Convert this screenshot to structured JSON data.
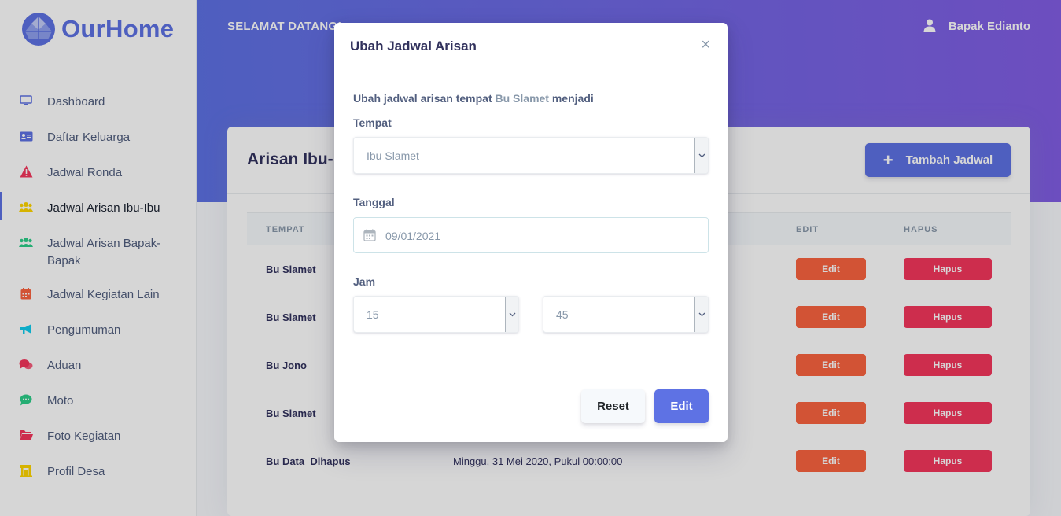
{
  "brand": {
    "name": "OurHome",
    "color": "#5e72e4"
  },
  "sidebar": {
    "items": [
      {
        "label": "Dashboard",
        "icon": "monitor-icon",
        "color": "#5e72e4"
      },
      {
        "label": "Daftar Keluarga",
        "icon": "id-card-icon",
        "color": "#5e72e4"
      },
      {
        "label": "Jadwal Ronda",
        "icon": "warning-icon",
        "color": "#f5365c"
      },
      {
        "label": "Jadwal Arisan Ibu-Ibu",
        "icon": "users-icon",
        "color": "#ffd600"
      },
      {
        "label": "Jadwal Arisan Bapak-Bapak",
        "icon": "users-icon",
        "color": "#2dce89"
      },
      {
        "label": "Jadwal Kegiatan Lain",
        "icon": "calendar-icon",
        "color": "#fb6340"
      },
      {
        "label": "Pengumuman",
        "icon": "megaphone-icon",
        "color": "#11cdef"
      },
      {
        "label": "Aduan",
        "icon": "comments-icon",
        "color": "#f5365c"
      },
      {
        "label": "Moto",
        "icon": "chat-bubble-icon",
        "color": "#2dce89"
      },
      {
        "label": "Foto Kegiatan",
        "icon": "folder-icon",
        "color": "#f5365c"
      },
      {
        "label": "Profil Desa",
        "icon": "building-icon",
        "color": "#ffd600"
      }
    ],
    "active_index": 3
  },
  "header": {
    "welcome": "SELAMAT DATANG!",
    "user_name": "Bapak Edianto"
  },
  "card": {
    "title": "Arisan Ibu-I",
    "add_button": "Tambah Jadwal",
    "columns": {
      "tempat": "TEMPAT",
      "edit": "EDIT",
      "hapus": "HAPUS"
    },
    "rows": [
      {
        "tempat": "Bu Slamet",
        "jadwal": ""
      },
      {
        "tempat": "Bu Slamet",
        "jadwal": ""
      },
      {
        "tempat": "Bu Jono",
        "jadwal": ""
      },
      {
        "tempat": "Bu Slamet",
        "jadwal": ""
      },
      {
        "tempat": "Bu Data_Dihapus",
        "jadwal": "Minggu, 31 Mei 2020, Pukul 00:00:00"
      }
    ],
    "edit_label": "Edit",
    "delete_label": "Hapus"
  },
  "modal": {
    "title": "Ubah Jadwal Arisan",
    "close": "×",
    "intro_prefix": "Ubah jadwal arisan tempat",
    "intro_name": "Bu Slamet",
    "intro_suffix": "menjadi",
    "tempat_label": "Tempat",
    "tempat_value": "Ibu Slamet",
    "tanggal_label": "Tanggal",
    "tanggal_value": "09/01/2021",
    "jam_label": "Jam",
    "jam_hour": "15",
    "jam_minute": "45",
    "reset_label": "Reset",
    "submit_label": "Edit"
  }
}
